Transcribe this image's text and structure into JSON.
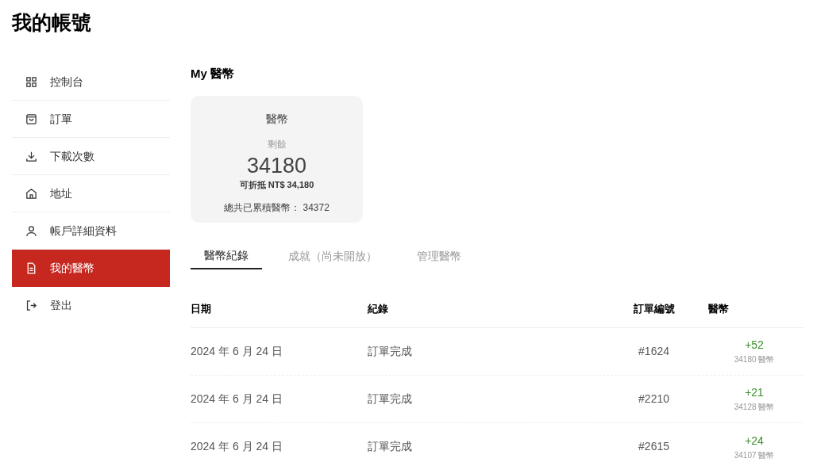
{
  "page_title": "我的帳號",
  "sidebar": {
    "items": [
      {
        "label": "控制台",
        "selected": false
      },
      {
        "label": "訂單",
        "selected": false
      },
      {
        "label": "下載次數",
        "selected": false
      },
      {
        "label": "地址",
        "selected": false
      },
      {
        "label": "帳戶詳細資料",
        "selected": false
      },
      {
        "label": "我的醫幣",
        "selected": true
      },
      {
        "label": "登出",
        "selected": false
      }
    ]
  },
  "section_title": "My 醫幣",
  "summary_card": {
    "title": "醫幣",
    "remaining_label": "剩餘",
    "balance": "34180",
    "discount": "可折抵 NT$ 34,180",
    "total": "總共已累積醫幣： 34372"
  },
  "tabs": [
    {
      "label": "醫幣紀錄",
      "selected": true
    },
    {
      "label": "成就（尚未開放）",
      "selected": false
    },
    {
      "label": "管理醫幣",
      "selected": false
    }
  ],
  "table": {
    "columns": [
      "日期",
      "紀錄",
      "訂單編號",
      "醫幣"
    ],
    "rows": [
      {
        "date": "2024 年 6 月 24 日",
        "record": "訂單完成",
        "order": "#1624",
        "change": "+52",
        "balance": "34180 醫幣"
      },
      {
        "date": "2024 年 6 月 24 日",
        "record": "訂單完成",
        "order": "#2210",
        "change": "+21",
        "balance": "34128 醫幣"
      },
      {
        "date": "2024 年 6 月 24 日",
        "record": "訂單完成",
        "order": "#2615",
        "change": "+24",
        "balance": "34107 醫幣"
      }
    ]
  }
}
